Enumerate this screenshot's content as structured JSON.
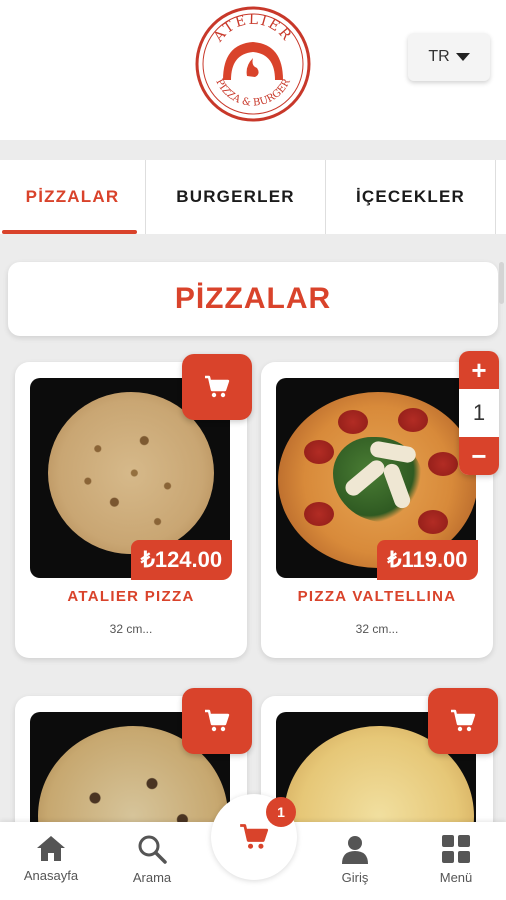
{
  "header": {
    "logo": {
      "top_text": "ATELIER",
      "bottom_text": "PIZZA & BURGER"
    },
    "language": "TR"
  },
  "tabs": [
    {
      "label": "PİZZALAR",
      "active": true
    },
    {
      "label": "BURGERLER",
      "active": false
    },
    {
      "label": "İÇECEKLER",
      "active": false
    }
  ],
  "section": {
    "title": "PİZZALAR"
  },
  "products": [
    {
      "name": "ATALIER PIZZA",
      "price": "₺124.00",
      "description": "32 cm..."
    },
    {
      "name": "PIZZA VALTELLINA",
      "price": "₺119.00",
      "description": "32 cm...",
      "quantity": "1",
      "plus": "+",
      "minus": "−"
    }
  ],
  "cart": {
    "count": "1"
  },
  "bottom_nav": {
    "home": "Anasayfa",
    "search": "Arama",
    "login": "Giriş",
    "menu": "Menü"
  },
  "colors": {
    "brand": "#d9432b",
    "background": "#ececec"
  },
  "icons": [
    "caret-down-icon",
    "cart-icon",
    "home-icon",
    "search-icon",
    "user-icon",
    "grid-menu-icon"
  ]
}
